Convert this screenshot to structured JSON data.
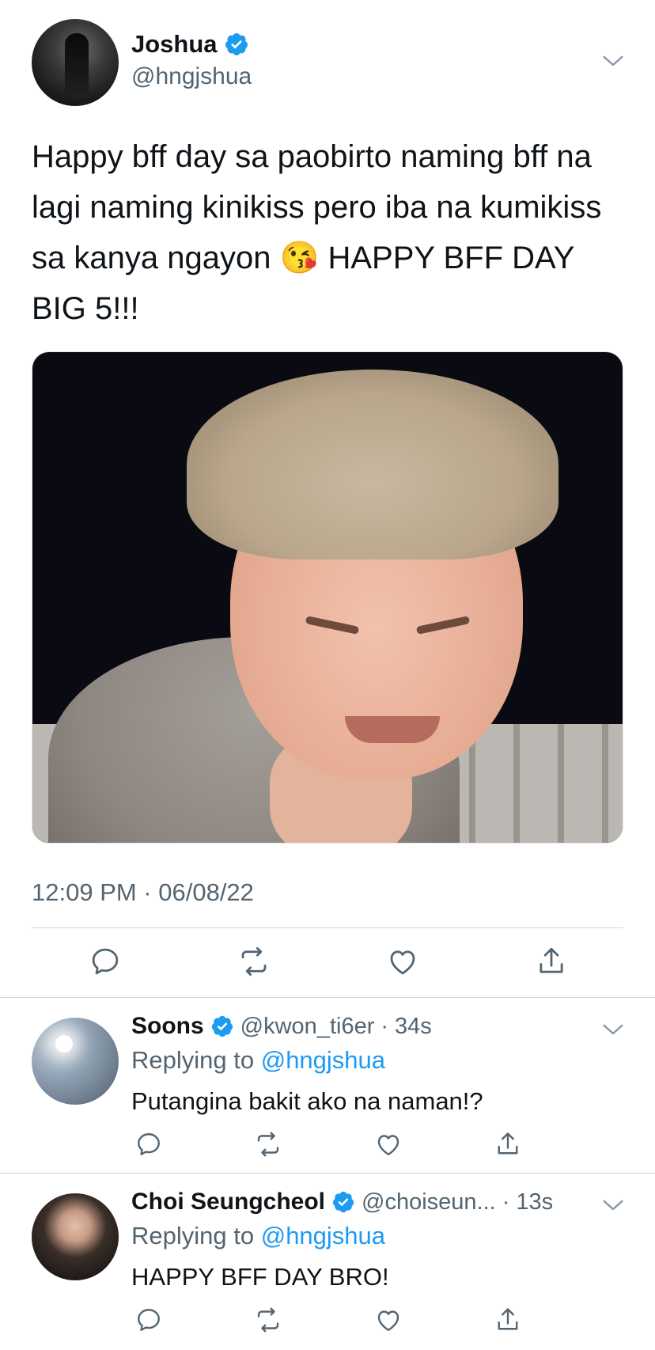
{
  "main_tweet": {
    "author_name": "Joshua",
    "author_handle": "@hngjshua",
    "text": "Happy bff day sa paobirto naming bff na lagi naming kinikiss pero iba na kumikiss sa kanya ngayon 😘 HAPPY BFF DAY BIG 5!!!",
    "timestamp": "12:09 PM · 06/08/22",
    "verified": true
  },
  "replies": [
    {
      "author_name": "Soons",
      "author_handle": "@kwon_ti6er",
      "time": "34s",
      "replying_prefix": "Replying to",
      "replying_to": "@hngjshua",
      "text": "Putangina bakit ako na naman!?",
      "verified": true
    },
    {
      "author_name": "Choi Seungcheol",
      "author_handle": "@choiseun...",
      "time": "13s",
      "replying_prefix": "Replying to",
      "replying_to": "@hngjshua",
      "text": "HAPPY BFF DAY BRO!",
      "verified": true
    }
  ],
  "icons": {
    "reply": "reply-icon",
    "retweet": "retweet-icon",
    "like": "heart-icon",
    "share": "share-icon",
    "verified": "verified-badge-icon",
    "more": "chevron-down-icon"
  },
  "colors": {
    "text": "#0f1419",
    "secondary": "#536471",
    "accent": "#1d9bf0",
    "divider": "#cfd9de"
  }
}
